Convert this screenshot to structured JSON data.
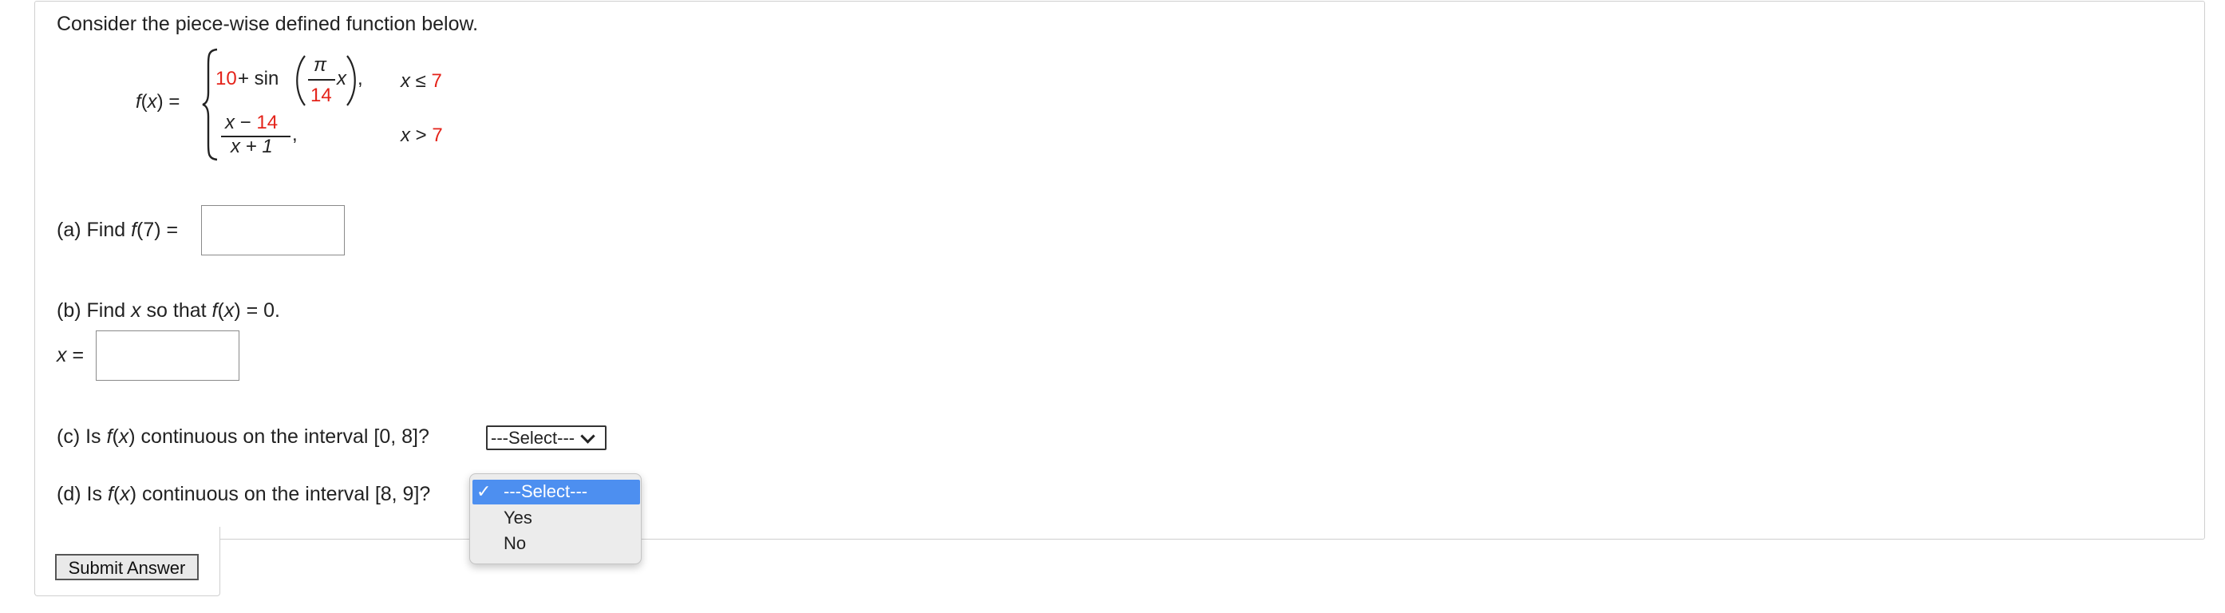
{
  "intro": "Consider the piece-wise defined function below.",
  "function": {
    "lhs_name": "f",
    "lhs_var": "x",
    "lhs_close": ") =",
    "case1": {
      "const": "10",
      "plus_sin": " + sin",
      "pi": "π",
      "denominator": "14",
      "var": "x",
      "close": "),",
      "cond_var": "x",
      "cond_op": " ≤ ",
      "cond_val": "7"
    },
    "case2": {
      "num_var": "x",
      "num_op": " − ",
      "num_val": "14",
      "den": "x + 1",
      "comma": ",",
      "cond_var": "x",
      "cond_op": " > ",
      "cond_val": "7"
    }
  },
  "part_a": {
    "prefix": "(a) Find ",
    "func": "f",
    "suffix": "(7) =",
    "answer_value": ""
  },
  "part_b": {
    "prefix": "(b) Find ",
    "var": "x",
    "middle": " so that ",
    "func": "f",
    "arg": "x",
    "suffix": ") = 0.",
    "answer_label_var": "x",
    "answer_label_eq": " =",
    "answer_value": ""
  },
  "part_c": {
    "prefix": "(c) Is ",
    "func": "f",
    "arg": "x",
    "suffix": ") continuous on the interval [0, 8]?",
    "select_value": "---Select---"
  },
  "part_d": {
    "prefix": "(d) Is ",
    "func": "f",
    "arg": "x",
    "suffix": ") continuous on the interval [8, 9]?",
    "dropdown": {
      "check": "✓",
      "options": [
        "---Select---",
        "Yes",
        "No"
      ],
      "selected_index": 0
    }
  },
  "submit_label": "Submit Answer",
  "colors": {
    "emphasis_red": "#e4231a",
    "dropdown_highlight": "#4d8ff0"
  }
}
